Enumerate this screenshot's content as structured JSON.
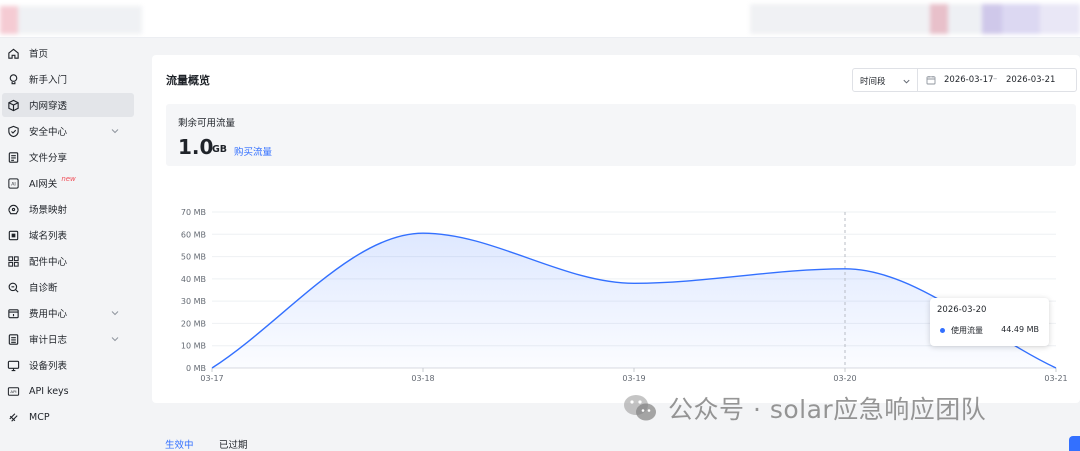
{
  "sidebar": {
    "items": [
      {
        "label": "首页",
        "icon": "home-icon"
      },
      {
        "label": "新手入门",
        "icon": "bulb-icon"
      },
      {
        "label": "内网穿透",
        "icon": "cube-icon",
        "active": true
      },
      {
        "label": "安全中心",
        "icon": "shield-icon",
        "expandable": true
      },
      {
        "label": "文件分享",
        "icon": "file-icon"
      },
      {
        "label": "AI网关",
        "icon": "ai-icon",
        "badge": "new"
      },
      {
        "label": "场景映射",
        "icon": "scene-icon"
      },
      {
        "label": "域名列表",
        "icon": "domain-icon"
      },
      {
        "label": "配件中心",
        "icon": "grid-icon"
      },
      {
        "label": "自诊断",
        "icon": "diagnose-icon"
      },
      {
        "label": "费用中心",
        "icon": "wallet-icon",
        "expandable": true
      },
      {
        "label": "审计日志",
        "icon": "log-icon",
        "expandable": true
      },
      {
        "label": "设备列表",
        "icon": "monitor-icon"
      },
      {
        "label": "API keys",
        "icon": "api-icon"
      },
      {
        "label": "MCP",
        "icon": "mcp-icon"
      }
    ]
  },
  "overview": {
    "title": "流量概览",
    "range_label": "时间段",
    "date_start": "2026-03-17",
    "date_sep": "–",
    "date_end": "2026-03-21"
  },
  "remaining": {
    "label": "剩余可用流量",
    "value": "1.0",
    "unit": "GB",
    "buy_link": "购买流量"
  },
  "chart_data": {
    "type": "area",
    "x": [
      "03-17",
      "03-18",
      "03-19",
      "03-20",
      "03-21"
    ],
    "series": [
      {
        "name": "使用流量",
        "values": [
          0,
          60.5,
          38,
          44.49,
          0
        ]
      }
    ],
    "yticks": [
      "0 MB",
      "10 MB",
      "20 MB",
      "30 MB",
      "40 MB",
      "50 MB",
      "60 MB",
      "70 MB"
    ],
    "ylim": [
      0,
      70
    ],
    "unit": "MB",
    "color": "#3370ff",
    "grid": true,
    "hover_index": 3,
    "tooltip": {
      "date": "2026-03-20",
      "series_name": "使用流量",
      "value": "44.49 MB"
    }
  },
  "tabs": [
    {
      "label": "生效中",
      "active": true
    },
    {
      "label": "已过期",
      "active": false
    }
  ],
  "watermark": {
    "text": "公众号 · solar应急响应团队"
  }
}
